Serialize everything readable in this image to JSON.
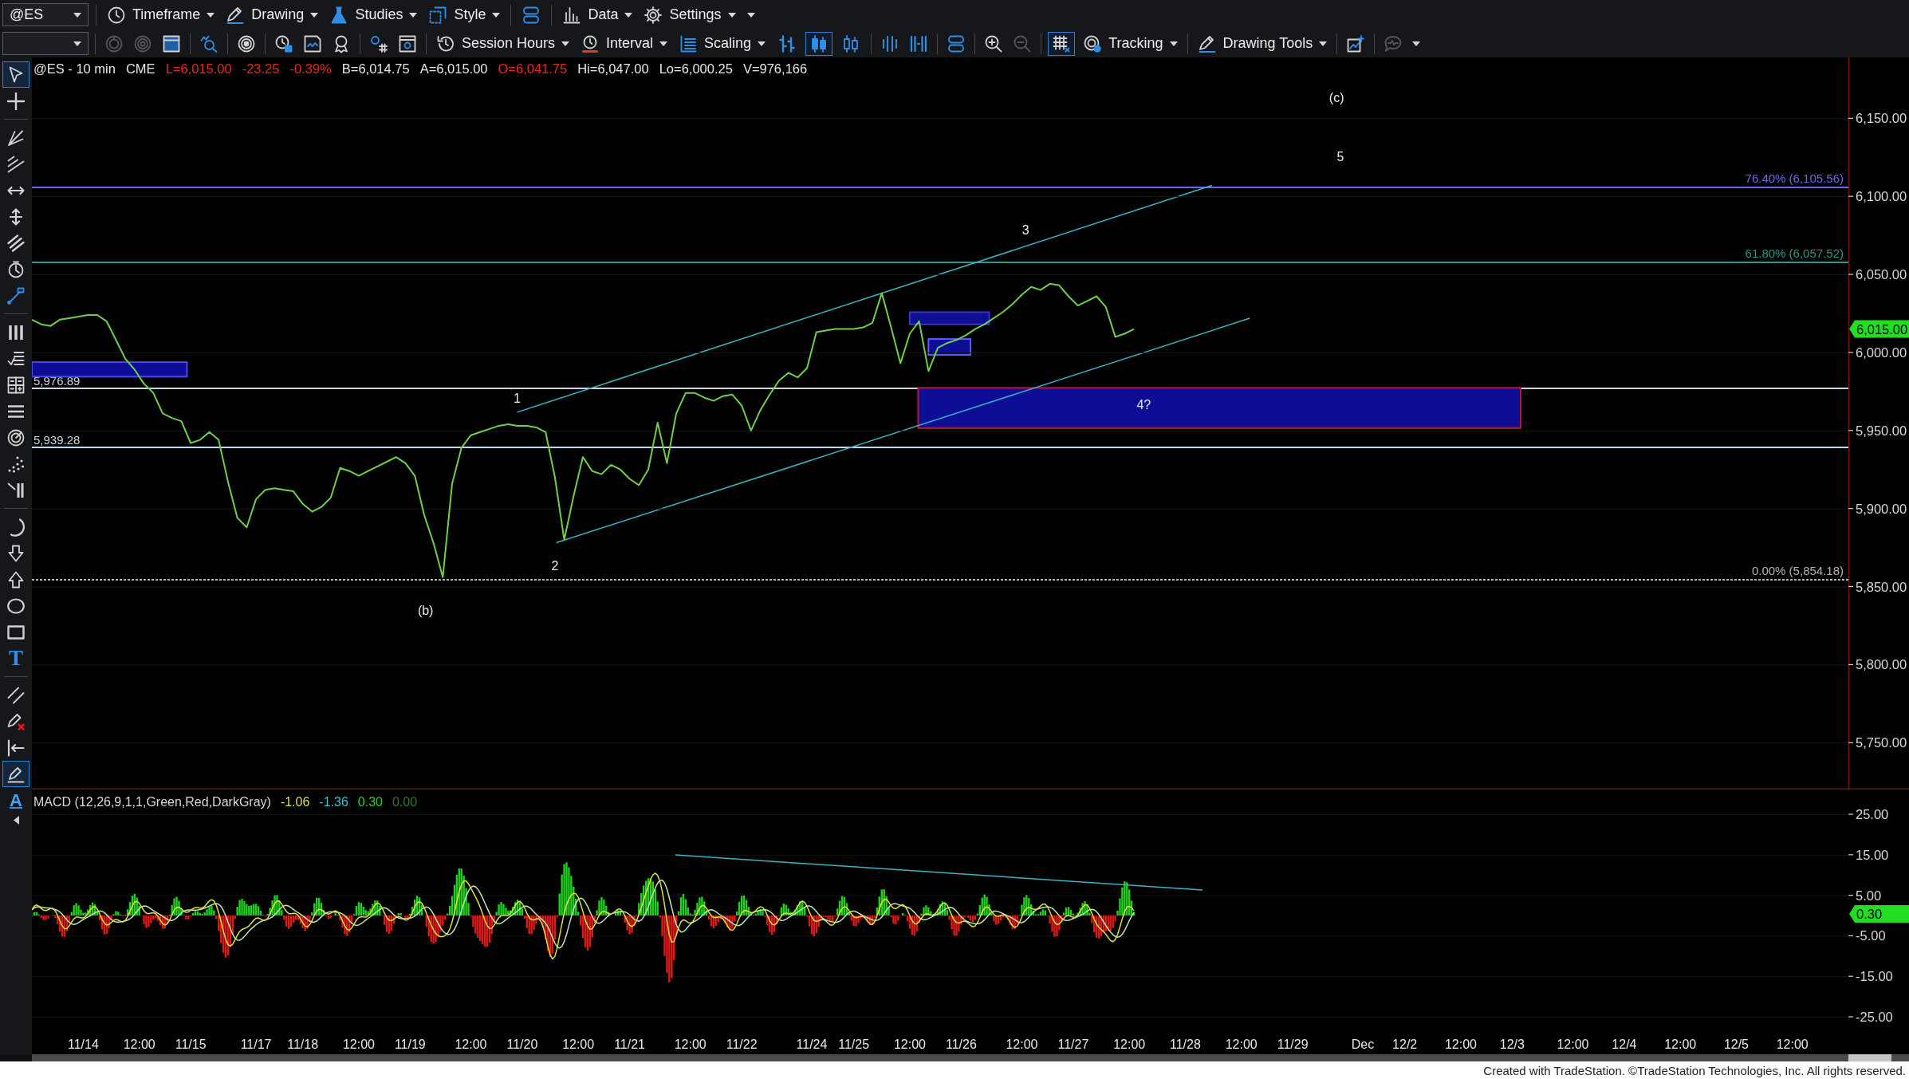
{
  "toolbar_top": {
    "groups": [
      [
        {
          "kind": "dropdown",
          "value": "@ES"
        }
      ],
      [
        {
          "kind": "menu",
          "label": "Timeframe"
        },
        {
          "kind": "menu",
          "label": "Drawing"
        },
        {
          "kind": "menu",
          "label": "Studies"
        },
        {
          "kind": "menu",
          "label": "Style"
        }
      ],
      [
        {
          "kind": "icon"
        }
      ],
      [
        {
          "kind": "menu",
          "label": "Data"
        },
        {
          "kind": "menu",
          "label": "Settings"
        },
        {
          "kind": "caret"
        }
      ]
    ]
  },
  "toolbar_bottom": {
    "groups": [
      [
        {
          "kind": "dropdown"
        }
      ],
      [
        {
          "kind": "icon",
          "disabled": true
        },
        {
          "kind": "icon",
          "disabled": true
        },
        {
          "kind": "icon",
          "disabled": false
        }
      ],
      [
        {
          "kind": "icon",
          "disabled": false
        }
      ],
      [
        {
          "kind": "icon",
          "disabled": false
        }
      ],
      [
        {
          "kind": "icon",
          "disabled": false
        },
        {
          "kind": "icon",
          "disabled": false
        },
        {
          "kind": "icon",
          "disabled": false
        }
      ],
      [
        {
          "kind": "icon",
          "disabled": false
        },
        {
          "kind": "icon",
          "disabled": false
        }
      ],
      [
        {
          "kind": "menu",
          "label": "Session Hours"
        },
        {
          "kind": "menu",
          "label": "Interval"
        },
        {
          "kind": "menu",
          "label": "Scaling"
        },
        {
          "kind": "toggle",
          "selected": false
        },
        {
          "kind": "toggle",
          "selected": true
        },
        {
          "kind": "toggle",
          "selected": false
        }
      ],
      [
        {
          "kind": "icon",
          "disabled": false
        },
        {
          "kind": "icon",
          "disabled": false
        }
      ],
      [
        {
          "kind": "icon",
          "disabled": false
        }
      ],
      [
        {
          "kind": "icon",
          "disabled": false
        },
        {
          "kind": "icon",
          "disabled": true
        }
      ],
      [
        {
          "kind": "toggle",
          "selected": true
        },
        {
          "kind": "menu",
          "label": "Tracking"
        }
      ],
      [
        {
          "kind": "menu",
          "label": "Drawing Tools"
        }
      ],
      [
        {
          "kind": "icon",
          "disabled": false
        }
      ],
      [
        {
          "kind": "icon",
          "disabled": true
        },
        {
          "kind": "caret"
        }
      ]
    ]
  },
  "left_toolbar": {
    "groups": [
      [
        {
          "kind": "icon",
          "selected": true
        },
        {
          "kind": "icon",
          "selected": false
        }
      ],
      [
        {
          "kind": "icon",
          "selected": false
        },
        {
          "kind": "icon",
          "selected": false
        },
        {
          "kind": "icon",
          "selected": false
        },
        {
          "kind": "icon",
          "selected": false
        },
        {
          "kind": "icon",
          "selected": false
        },
        {
          "kind": "icon",
          "selected": false
        },
        {
          "kind": "icon",
          "selected": false
        }
      ],
      [
        {
          "kind": "icon",
          "selected": false
        },
        {
          "kind": "icon",
          "selected": false
        },
        {
          "kind": "icon",
          "selected": false
        },
        {
          "kind": "icon",
          "selected": false
        },
        {
          "kind": "icon",
          "selected": false
        },
        {
          "kind": "icon",
          "selected": false
        },
        {
          "kind": "icon",
          "selected": false
        }
      ],
      [
        {
          "kind": "icon",
          "selected": false
        },
        {
          "kind": "icon",
          "selected": false
        },
        {
          "kind": "icon",
          "selected": false
        },
        {
          "kind": "icon",
          "selected": false
        },
        {
          "kind": "icon",
          "selected": false
        },
        {
          "kind": "glyph",
          "glyph": "T",
          "selected": false
        }
      ],
      [
        {
          "kind": "icon",
          "selected": false
        },
        {
          "kind": "icon",
          "selected": false
        },
        {
          "kind": "icon",
          "selected": false
        },
        {
          "kind": "icon",
          "selected": true
        },
        {
          "kind": "glyph",
          "glyph": "A",
          "selected": false
        }
      ]
    ]
  },
  "price_pane": {
    "header": [
      {
        "text": "@ES - 10 min",
        "color": "#e6e6e6"
      },
      {
        "text": "CME",
        "color": "#e6e6e6"
      },
      {
        "text": "L=6,015.00",
        "color": "#e8261f"
      },
      {
        "text": "-23.25",
        "color": "#e8261f"
      },
      {
        "text": "-0.39%",
        "color": "#e8261f"
      },
      {
        "text": "B=6,014.75",
        "color": "#e6e6e6"
      },
      {
        "text": "A=6,015.00",
        "color": "#e6e6e6"
      },
      {
        "text": "O=6,041.75",
        "color": "#e8261f"
      },
      {
        "text": "Hi=6,047.00",
        "color": "#e6e6e6"
      },
      {
        "text": "Lo=6,000.25",
        "color": "#e6e6e6"
      },
      {
        "text": "V=976,166",
        "color": "#e6e6e6"
      }
    ],
    "last_price_tag": "6,015.00",
    "drawings": {
      "levels": [
        {
          "label": "76.40% (6,105.56)",
          "color": "#6a6ae6"
        },
        {
          "label": "61.80% (6,057.52)",
          "color": "#2a9686"
        },
        {
          "label": "5,976.89",
          "color": "#c8d6e6"
        },
        {
          "label": "5,939.28",
          "color": "#c8d6e6"
        },
        {
          "label": "0.00% (5,854.18)",
          "color": "#b4b4b4"
        }
      ],
      "zones": [
        {
          "color": "#3434c8"
        },
        {
          "color": "#5c5cff"
        },
        {
          "color": "#4a4ae8"
        },
        {
          "color": "#c0143c"
        }
      ],
      "wave_labels": [
        "(c)",
        "5",
        "3",
        "4?",
        "1",
        "2",
        "(b)"
      ]
    },
    "chart_data": {
      "type": "line",
      "categories": [
        null,
        null,
        null,
        null,
        null,
        null,
        null,
        null,
        null,
        null,
        null,
        null,
        null,
        null,
        null,
        null,
        null,
        null,
        null,
        null,
        null,
        null,
        null,
        null,
        null,
        null,
        null,
        null,
        null,
        null,
        null,
        null,
        null,
        null,
        null,
        null,
        null,
        null,
        null,
        null,
        null,
        null,
        null,
        null,
        null,
        null,
        null,
        null,
        null,
        null,
        null,
        null,
        null,
        null,
        null,
        null,
        null,
        null,
        null,
        null,
        null,
        null,
        null,
        null,
        null,
        null,
        null,
        null,
        null,
        null,
        null,
        null,
        null,
        null,
        null,
        null,
        null,
        null,
        null,
        null,
        null,
        null,
        null,
        null,
        null,
        null,
        null,
        null,
        null,
        null,
        null,
        null,
        null,
        null,
        null,
        null,
        null,
        null,
        null,
        null,
        null,
        null,
        null,
        null,
        null,
        null,
        null,
        null,
        null,
        null,
        null,
        null,
        null,
        null,
        null,
        null,
        null,
        null,
        null,
        null,
        null,
        null,
        null,
        null,
        null,
        null,
        null,
        null,
        null,
        null,
        null,
        null,
        null,
        null,
        null,
        null,
        null,
        null,
        null,
        null,
        null,
        null,
        null,
        null,
        null,
        null,
        null,
        null,
        null,
        null,
        null,
        null,
        null,
        null,
        null,
        null,
        null,
        null,
        null,
        null,
        null,
        null,
        null,
        null,
        null,
        null,
        null,
        null,
        null,
        null,
        null,
        null,
        null,
        null,
        null,
        null,
        null,
        null,
        null,
        null,
        null,
        null,
        null,
        null,
        null,
        null,
        null,
        null,
        null,
        null,
        null,
        null,
        null,
        null,
        null
      ],
      "series": [
        {
          "color": "#6fcf48",
          "values": [
            6021,
            6018,
            6017,
            6021,
            6022,
            6023,
            6024,
            6024,
            6020,
            6008,
            5996,
            5989,
            5980,
            5974,
            5961,
            5958,
            5956,
            5942,
            5944,
            5949,
            5944,
            5917,
            5894,
            5888,
            5906,
            5912,
            5913,
            5912,
            5911,
            5903,
            5898,
            5901,
            5907,
            5926,
            5924,
            5921,
            5924,
            5927,
            5930,
            5933,
            5929,
            5921,
            5896,
            5878,
            5856,
            5916,
            5939,
            5947,
            5949,
            5951,
            5953,
            5954,
            5953,
            5953,
            5952,
            5949,
            5920,
            5880,
            5908,
            5933,
            5924,
            5922,
            5928,
            5925,
            5919,
            5915,
            5925,
            5955,
            5929,
            5961,
            5974,
            5974,
            5971,
            5969,
            5972,
            5973,
            5966,
            5950,
            5963,
            5973,
            5982,
            5987,
            5984,
            5990,
            6013,
            6014,
            6015,
            6015,
            6015,
            6016,
            6019,
            6038,
            6016,
            5993,
            6012,
            6020,
            5988,
            6003,
            6006,
            6008,
            6011,
            6015,
            6018,
            6022,
            6026,
            6031,
            6037,
            6042,
            6040,
            6044,
            6043,
            6036,
            6030,
            6033,
            6036,
            6029,
            6010,
            6012,
            6015,
            null,
            null,
            null,
            null,
            null,
            null,
            null,
            null,
            null,
            null,
            null,
            null,
            null,
            null,
            null,
            null,
            null,
            null,
            null,
            null,
            null,
            null,
            null,
            null,
            null,
            null,
            null,
            null,
            null,
            null,
            null,
            null,
            null,
            null,
            null,
            null,
            null,
            null,
            null,
            null,
            null,
            null,
            null,
            null,
            null,
            null,
            null,
            null,
            null,
            null,
            null,
            null,
            null,
            null,
            null,
            null,
            null,
            null,
            null,
            null,
            null,
            null,
            null,
            null,
            null,
            null,
            null,
            null,
            null,
            null,
            null,
            null,
            null,
            null,
            null,
            null
          ]
        }
      ],
      "ylim": [
        5720,
        6189
      ],
      "yticks": [
        {
          "value": 6150,
          "label": "6,150.00"
        },
        {
          "value": 6100,
          "label": "6,100.00"
        },
        {
          "value": 6050,
          "label": "6,050.00"
        },
        {
          "value": 6000,
          "label": "6,000.00"
        },
        {
          "value": 5950,
          "label": "5,950.00"
        },
        {
          "value": 5900,
          "label": "5,900.00"
        },
        {
          "value": 5850,
          "label": "5,850.00"
        },
        {
          "value": 5800,
          "label": "5,800.00"
        },
        {
          "value": 5750,
          "label": "5,750.00"
        }
      ]
    }
  },
  "macd_pane": {
    "title": "MACD (12,26,9,1,1,Green,Red,DarkGray)",
    "readings": [
      {
        "text": "-1.06",
        "color": "#dede50"
      },
      {
        "text": "-1.36",
        "color": "#3cc0d0"
      },
      {
        "text": "0.30",
        "color": "#34c834"
      },
      {
        "text": "0.00",
        "color": "#2a7a2a"
      }
    ],
    "axis_labels": [
      "25.00",
      "15.00",
      "5.00",
      "-5.00",
      "-15.00",
      "-25.00"
    ],
    "last_value_tag": "0.30"
  },
  "time_axis": {
    "labels": [
      "11/14",
      "12:00",
      "11/15",
      "11/17",
      "11/18",
      "12:00",
      "11/19",
      "12:00",
      "11/20",
      "12:00",
      "11/21",
      "12:00",
      "11/22",
      "11/24",
      "11/25",
      "12:00",
      "11/26",
      "12:00",
      "11/27",
      "12:00",
      "11/28",
      "12:00",
      "11/29",
      "Dec",
      "12/2",
      "12:00",
      "12/3",
      "12:00",
      "12/4",
      "12:00",
      "12/5",
      "12:00"
    ]
  },
  "footer": {
    "text": "Created with TradeStation. ©TradeStation Technologies, Inc. All rights reserved."
  }
}
